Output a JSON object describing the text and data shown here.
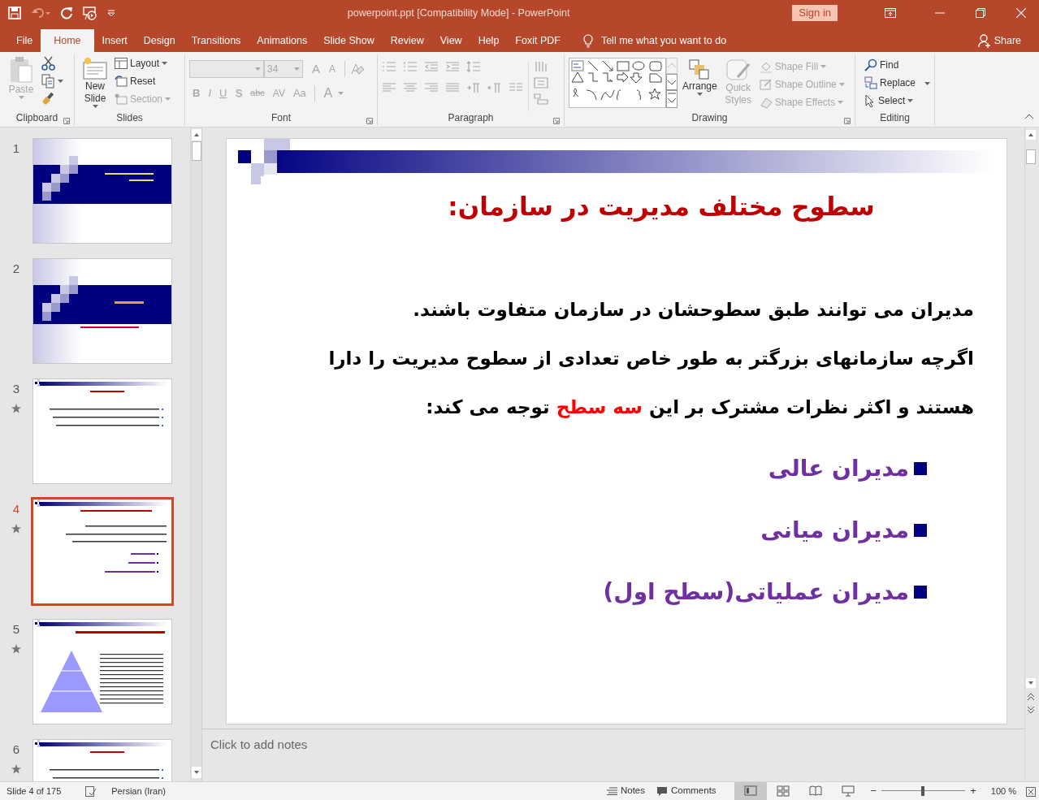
{
  "window": {
    "title": "powerpoint.ppt [Compatibility Mode]  -  PowerPoint",
    "sign_in": "Sign in"
  },
  "ribbon_tabs": [
    {
      "label": "File",
      "selected": false
    },
    {
      "label": "Home",
      "selected": true
    },
    {
      "label": "Insert",
      "selected": false
    },
    {
      "label": "Design",
      "selected": false
    },
    {
      "label": "Transitions",
      "selected": false
    },
    {
      "label": "Animations",
      "selected": false
    },
    {
      "label": "Slide Show",
      "selected": false
    },
    {
      "label": "Review",
      "selected": false
    },
    {
      "label": "View",
      "selected": false
    },
    {
      "label": "Help",
      "selected": false
    },
    {
      "label": "Foxit PDF",
      "selected": false
    }
  ],
  "tell_me": "Tell me what you want to do",
  "share": "Share",
  "ribbon": {
    "clipboard": {
      "label": "Clipboard",
      "paste": {
        "label": "Paste",
        "disabled": true
      }
    },
    "slides": {
      "label": "Slides",
      "new_slide": "New Slide",
      "layout": "Layout",
      "reset": "Reset",
      "section": {
        "label": "Section",
        "disabled": true
      }
    },
    "font": {
      "label": "Font",
      "disabled": true,
      "size": "34",
      "grow": "A",
      "shrink": "A",
      "buttons": [
        "B",
        "I",
        "U",
        "S",
        "abc",
        "AV",
        "Aa"
      ],
      "color_button": "A"
    },
    "paragraph": {
      "label": "Paragraph",
      "disabled": true
    },
    "drawing": {
      "label": "Drawing",
      "arrange": "Arrange",
      "quick_styles": {
        "label": "Quick Styles",
        "disabled": true
      },
      "shape_buttons": [
        {
          "kind": "fill",
          "label": "Shape Fill",
          "disabled": true
        },
        {
          "kind": "outline",
          "label": "Shape Outline",
          "disabled": true
        },
        {
          "kind": "effects",
          "label": "Shape Effects",
          "disabled": true
        }
      ]
    },
    "editing": {
      "label": "Editing",
      "find": "Find",
      "replace": "Replace",
      "select": "Select"
    }
  },
  "slides": [
    {
      "number": "1",
      "selected": false,
      "animated": false,
      "kind": "title"
    },
    {
      "number": "2",
      "selected": false,
      "animated": false,
      "kind": "title-subtitle"
    },
    {
      "number": "3",
      "selected": false,
      "animated": true,
      "kind": "list"
    },
    {
      "number": "4",
      "selected": true,
      "animated": true,
      "kind": "bullets"
    },
    {
      "number": "5",
      "selected": false,
      "animated": true,
      "kind": "pyramid"
    },
    {
      "number": "6",
      "selected": false,
      "animated": true,
      "kind": "list"
    }
  ],
  "editor": {
    "slide": {
      "kind": "bullets",
      "title": "سطوح مختلف مدیریت در سازمان:",
      "paragraphs": [
        [
          {
            "text": "مدیران می توانند طبق سطوحشان در سازمان متفاوت باشند.",
            "highlight": false
          }
        ],
        [
          {
            "text": "اگرچه سازمانهای بزرگتر به طور خاص تعدادی از سطوح مدیریت را دارا هستند و اکثر نظرات مشترک بر این ",
            "highlight": false
          },
          {
            "text": "سه سطح",
            "highlight": true
          },
          {
            "text": " توجه می کند:",
            "highlight": false
          }
        ]
      ],
      "bullets": [
        "مدیران عالی",
        "مدیران میانی",
        "مدیران عملیاتی(سطح اول)"
      ]
    },
    "notes_placeholder": "Click to add notes"
  },
  "status_bar": {
    "slide_info": "Slide 4 of 175",
    "language": "Persian (Iran)",
    "notes": "Notes",
    "comments": "Comments",
    "views": [
      {
        "selected": true
      },
      {
        "selected": false
      },
      {
        "selected": false
      },
      {
        "selected": false
      }
    ],
    "zoom_out": "−",
    "zoom_in": "+",
    "zoom": {
      "level": 0.49
    },
    "zoom_reading": "100 %"
  }
}
